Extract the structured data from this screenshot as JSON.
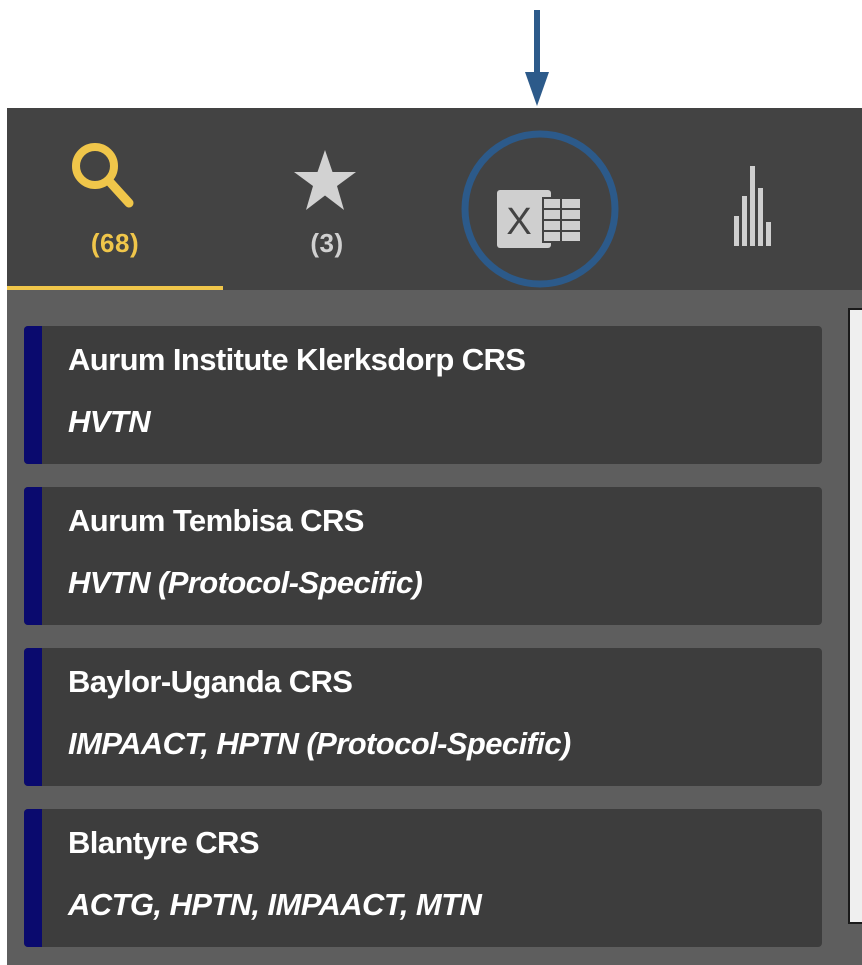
{
  "toolbar": {
    "search": {
      "icon": "search-icon",
      "count": "(68)",
      "active": true,
      "accent_color": "#f0c64a"
    },
    "favorites": {
      "icon": "star-icon",
      "count": "(3)"
    },
    "export": {
      "icon": "excel-export-icon",
      "highlight_color": "#2c5a8a"
    },
    "stats": {
      "icon": "bar-chart-icon"
    }
  },
  "annotation": {
    "icon": "down-arrow-icon",
    "color": "#2c5a8a"
  },
  "results": [
    {
      "name": "Aurum Institute Klerksdorp CRS",
      "networks": "HVTN"
    },
    {
      "name": "Aurum Tembisa CRS",
      "networks": "HVTN (Protocol-Specific)"
    },
    {
      "name": "Baylor-Uganda CRS",
      "networks": "IMPAACT, HPTN (Protocol-Specific)"
    },
    {
      "name": "Blantyre CRS",
      "networks": "ACTG, HPTN, IMPAACT, MTN"
    }
  ]
}
